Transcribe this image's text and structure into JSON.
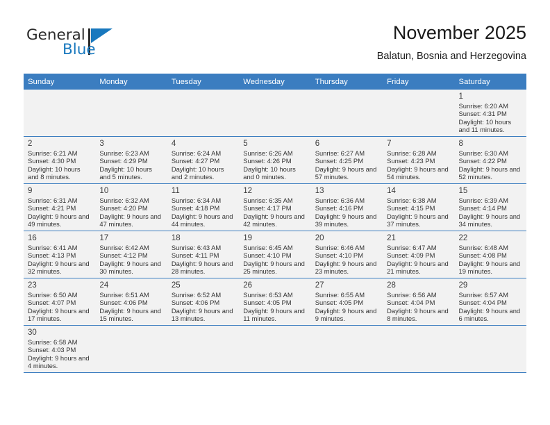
{
  "brand": {
    "name_top": "General",
    "name_bottom": "Blue",
    "color_blue": "#1878be",
    "color_dark": "#2b2b2b",
    "logo_icon": "triangle-flag-icon"
  },
  "header": {
    "title": "November 2025",
    "subtitle": "Balatun, Bosnia and Herzegovina"
  },
  "theme": {
    "header_row_bg": "#3b7dc0",
    "cell_shade_bg": "#f2f2f2",
    "grid_line": "#3b7dc0"
  },
  "weekdays": [
    "Sunday",
    "Monday",
    "Tuesday",
    "Wednesday",
    "Thursday",
    "Friday",
    "Saturday"
  ],
  "labels": {
    "sunrise": "Sunrise:",
    "sunset": "Sunset:",
    "daylight": "Daylight:"
  },
  "weeks": [
    [
      {
        "empty": true
      },
      {
        "empty": true
      },
      {
        "empty": true
      },
      {
        "empty": true
      },
      {
        "empty": true
      },
      {
        "empty": true
      },
      {
        "day": "1",
        "sunrise": "Sunrise: 6:20 AM",
        "sunset": "Sunset: 4:31 PM",
        "daylight": "Daylight: 10 hours and 11 minutes."
      }
    ],
    [
      {
        "day": "2",
        "sunrise": "Sunrise: 6:21 AM",
        "sunset": "Sunset: 4:30 PM",
        "daylight": "Daylight: 10 hours and 8 minutes."
      },
      {
        "day": "3",
        "sunrise": "Sunrise: 6:23 AM",
        "sunset": "Sunset: 4:29 PM",
        "daylight": "Daylight: 10 hours and 5 minutes."
      },
      {
        "day": "4",
        "sunrise": "Sunrise: 6:24 AM",
        "sunset": "Sunset: 4:27 PM",
        "daylight": "Daylight: 10 hours and 2 minutes."
      },
      {
        "day": "5",
        "sunrise": "Sunrise: 6:26 AM",
        "sunset": "Sunset: 4:26 PM",
        "daylight": "Daylight: 10 hours and 0 minutes."
      },
      {
        "day": "6",
        "sunrise": "Sunrise: 6:27 AM",
        "sunset": "Sunset: 4:25 PM",
        "daylight": "Daylight: 9 hours and 57 minutes."
      },
      {
        "day": "7",
        "sunrise": "Sunrise: 6:28 AM",
        "sunset": "Sunset: 4:23 PM",
        "daylight": "Daylight: 9 hours and 54 minutes."
      },
      {
        "day": "8",
        "sunrise": "Sunrise: 6:30 AM",
        "sunset": "Sunset: 4:22 PM",
        "daylight": "Daylight: 9 hours and 52 minutes."
      }
    ],
    [
      {
        "day": "9",
        "sunrise": "Sunrise: 6:31 AM",
        "sunset": "Sunset: 4:21 PM",
        "daylight": "Daylight: 9 hours and 49 minutes."
      },
      {
        "day": "10",
        "sunrise": "Sunrise: 6:32 AM",
        "sunset": "Sunset: 4:20 PM",
        "daylight": "Daylight: 9 hours and 47 minutes."
      },
      {
        "day": "11",
        "sunrise": "Sunrise: 6:34 AM",
        "sunset": "Sunset: 4:18 PM",
        "daylight": "Daylight: 9 hours and 44 minutes."
      },
      {
        "day": "12",
        "sunrise": "Sunrise: 6:35 AM",
        "sunset": "Sunset: 4:17 PM",
        "daylight": "Daylight: 9 hours and 42 minutes."
      },
      {
        "day": "13",
        "sunrise": "Sunrise: 6:36 AM",
        "sunset": "Sunset: 4:16 PM",
        "daylight": "Daylight: 9 hours and 39 minutes."
      },
      {
        "day": "14",
        "sunrise": "Sunrise: 6:38 AM",
        "sunset": "Sunset: 4:15 PM",
        "daylight": "Daylight: 9 hours and 37 minutes."
      },
      {
        "day": "15",
        "sunrise": "Sunrise: 6:39 AM",
        "sunset": "Sunset: 4:14 PM",
        "daylight": "Daylight: 9 hours and 34 minutes."
      }
    ],
    [
      {
        "day": "16",
        "sunrise": "Sunrise: 6:41 AM",
        "sunset": "Sunset: 4:13 PM",
        "daylight": "Daylight: 9 hours and 32 minutes."
      },
      {
        "day": "17",
        "sunrise": "Sunrise: 6:42 AM",
        "sunset": "Sunset: 4:12 PM",
        "daylight": "Daylight: 9 hours and 30 minutes."
      },
      {
        "day": "18",
        "sunrise": "Sunrise: 6:43 AM",
        "sunset": "Sunset: 4:11 PM",
        "daylight": "Daylight: 9 hours and 28 minutes."
      },
      {
        "day": "19",
        "sunrise": "Sunrise: 6:45 AM",
        "sunset": "Sunset: 4:10 PM",
        "daylight": "Daylight: 9 hours and 25 minutes."
      },
      {
        "day": "20",
        "sunrise": "Sunrise: 6:46 AM",
        "sunset": "Sunset: 4:10 PM",
        "daylight": "Daylight: 9 hours and 23 minutes."
      },
      {
        "day": "21",
        "sunrise": "Sunrise: 6:47 AM",
        "sunset": "Sunset: 4:09 PM",
        "daylight": "Daylight: 9 hours and 21 minutes."
      },
      {
        "day": "22",
        "sunrise": "Sunrise: 6:48 AM",
        "sunset": "Sunset: 4:08 PM",
        "daylight": "Daylight: 9 hours and 19 minutes."
      }
    ],
    [
      {
        "day": "23",
        "sunrise": "Sunrise: 6:50 AM",
        "sunset": "Sunset: 4:07 PM",
        "daylight": "Daylight: 9 hours and 17 minutes."
      },
      {
        "day": "24",
        "sunrise": "Sunrise: 6:51 AM",
        "sunset": "Sunset: 4:06 PM",
        "daylight": "Daylight: 9 hours and 15 minutes."
      },
      {
        "day": "25",
        "sunrise": "Sunrise: 6:52 AM",
        "sunset": "Sunset: 4:06 PM",
        "daylight": "Daylight: 9 hours and 13 minutes."
      },
      {
        "day": "26",
        "sunrise": "Sunrise: 6:53 AM",
        "sunset": "Sunset: 4:05 PM",
        "daylight": "Daylight: 9 hours and 11 minutes."
      },
      {
        "day": "27",
        "sunrise": "Sunrise: 6:55 AM",
        "sunset": "Sunset: 4:05 PM",
        "daylight": "Daylight: 9 hours and 9 minutes."
      },
      {
        "day": "28",
        "sunrise": "Sunrise: 6:56 AM",
        "sunset": "Sunset: 4:04 PM",
        "daylight": "Daylight: 9 hours and 8 minutes."
      },
      {
        "day": "29",
        "sunrise": "Sunrise: 6:57 AM",
        "sunset": "Sunset: 4:04 PM",
        "daylight": "Daylight: 9 hours and 6 minutes."
      }
    ],
    [
      {
        "day": "30",
        "sunrise": "Sunrise: 6:58 AM",
        "sunset": "Sunset: 4:03 PM",
        "daylight": "Daylight: 9 hours and 4 minutes."
      },
      {
        "empty": true
      },
      {
        "empty": true
      },
      {
        "empty": true
      },
      {
        "empty": true
      },
      {
        "empty": true
      },
      {
        "empty": true
      }
    ]
  ]
}
